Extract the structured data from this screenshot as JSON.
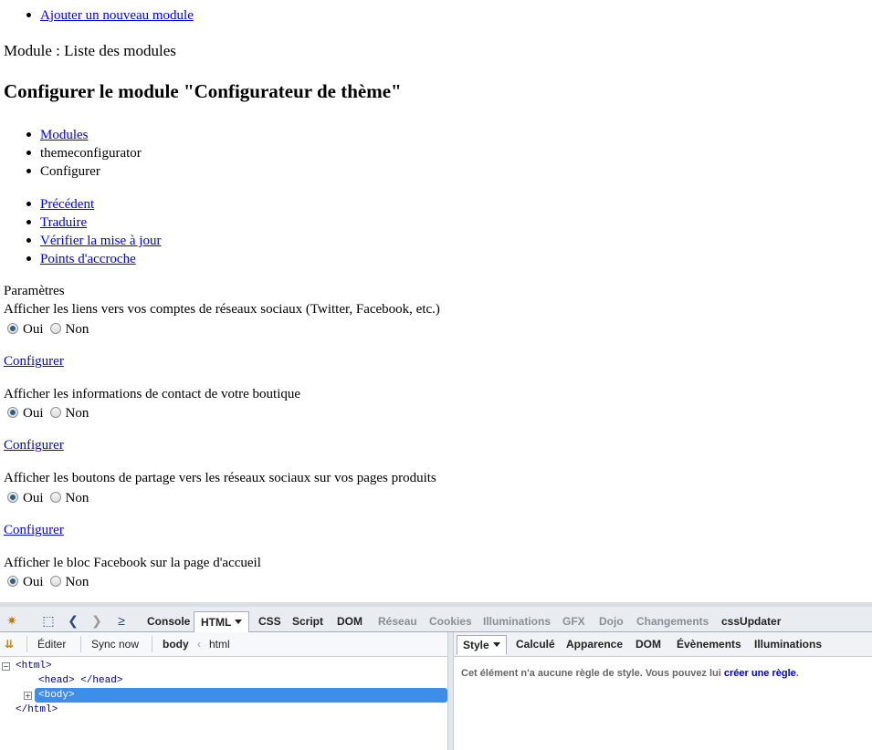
{
  "page": {
    "top_links": [
      "Ajouter un nouveau module"
    ],
    "module_line": "Module : Liste des modules",
    "title": "Configurer le module \"Configurateur de thème\"",
    "breadcrumb": [
      "Modules",
      "themeconfigurator",
      "Configurer"
    ],
    "actions": [
      "Précédent",
      "Traduire",
      "Vérifier la mise à jour",
      "Points d'accroche"
    ],
    "params_label": "Paramètres",
    "settings": [
      {
        "label": "Afficher les liens vers vos comptes de réseaux sociaux (Twitter, Facebook, etc.)",
        "yes": "Oui",
        "no": "Non",
        "selected": "Oui",
        "configure": "Configurer"
      },
      {
        "label": "Afficher les informations de contact de votre boutique",
        "yes": "Oui",
        "no": "Non",
        "selected": "Oui",
        "configure": "Configurer"
      },
      {
        "label": "Afficher les boutons de partage vers les réseaux sociaux sur vos pages produits",
        "yes": "Oui",
        "no": "Non",
        "selected": "Oui",
        "configure": "Configurer"
      },
      {
        "label": "Afficher le bloc Facebook sur la page d'accueil",
        "yes": "Oui",
        "no": "Non",
        "selected": "Oui"
      }
    ]
  },
  "devtools": {
    "tabs": [
      "Console",
      "HTML",
      "CSS",
      "Script",
      "DOM",
      "Réseau",
      "Cookies",
      "Illuminations",
      "GFX",
      "Dojo",
      "Changements",
      "cssUpdater"
    ],
    "active_tab": "HTML",
    "toolbar": {
      "edit": "Éditer",
      "sync": "Sync now",
      "crumb_active": "body",
      "crumb_parent": "html"
    },
    "side_tabs": [
      "Style",
      "Calculé",
      "Apparence",
      "DOM",
      "Évènements",
      "Illuminations"
    ],
    "tree": [
      "<html>",
      "<head> </head>",
      "<body>",
      "</html>"
    ],
    "style_message": "Cet élément n'a aucune règle de style. Vous pouvez lui",
    "style_link": "créer une règle",
    "style_period": "."
  }
}
